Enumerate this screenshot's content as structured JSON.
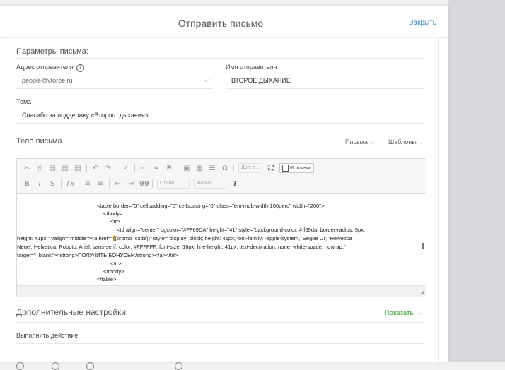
{
  "modal": {
    "title": "Отправить письмо",
    "close_label": "Закрыть"
  },
  "params": {
    "section_title": "Параметры письма:",
    "sender_address_label": "Адрес отправителя",
    "sender_address_value": "people@vtoroe.ru",
    "sender_name_label": "Имя отправителя",
    "sender_name_value": "ВТОРОЕ ДЫХАНИЕ",
    "subject_label": "Тема",
    "subject_value": "Спасибо за поддержку «Второго дыхания»"
  },
  "body": {
    "section_title": "Тело письма",
    "tab_letters": "Письма",
    "tab_templates": "Шаблоны"
  },
  "toolbar": {
    "row1": [
      "cut-icon",
      "copy-icon",
      "paste-icon",
      "paste-text-icon",
      "paste-word-icon",
      "undo-icon",
      "redo-icon",
      "spellcheck-icon",
      "link-icon",
      "unlink-icon",
      "anchor-icon",
      "image-icon",
      "table-icon",
      "hr-icon",
      "special-char-icon"
    ],
    "row1_glyphs": [
      "✂",
      "⎘",
      "▤",
      "▤",
      "▤",
      "↶",
      "↷",
      "✓",
      "∞",
      "⚭",
      "⚑",
      "▣",
      "▦",
      "☰",
      "Ω"
    ],
    "combo_placeholder": "Доп. п...",
    "maximize_glyph": "⛶",
    "source_label": "Источник",
    "row2_glyphs": [
      "B",
      "I",
      "S",
      "Tx",
      "≡",
      "≡",
      "⇤",
      "⇥",
      "99"
    ],
    "styles_placeholder": "Стили",
    "format_placeholder": "Форма...",
    "help_glyph": "?"
  },
  "code": {
    "line1": "<table border=\"0\" cellpadding=\"0\" cellspacing=\"0\" class=\"em-mob-width-100perc\" width=\"200\">",
    "line2": "<tbody>",
    "line3": "<tr>",
    "line4a": "<td align=\"center\" bgcolor=\"#FF69DA\" height=\"41\" style=\"background-color: #ff69da; border-radius: 5px;",
    "line4b_pre": "height: 41px;\" valign=\"middle\"><a href=\"",
    "line4b_hl": "{",
    "line4b_post": "{promo_code}}\" style=\"display: block; height: 41px; font-family: -apple-system, 'Segoe UI', 'Helvetica",
    "line4c": "Neue', Helvetica, Roboto, Arial, sans-serif; color: #FFFFFF; font-size: 16px; line-height: 41px; text-decoration: none; white-space: nowrap;\"",
    "line4d": "target=\"_blank\"><strong>ПОЛУЧИТЬ БОНУСЫ</strong></a></td>",
    "line5": "</tr>",
    "line6": "</tbody>",
    "line7": "</table>"
  },
  "extra": {
    "section_title": "Дополнительные настройки",
    "show_label": "Показать",
    "action_label": "Выполнить действие:"
  },
  "colors": {
    "link_blue": "#3a86c8",
    "show_green": "#5cb85c",
    "highlight": "#ffcc33"
  }
}
